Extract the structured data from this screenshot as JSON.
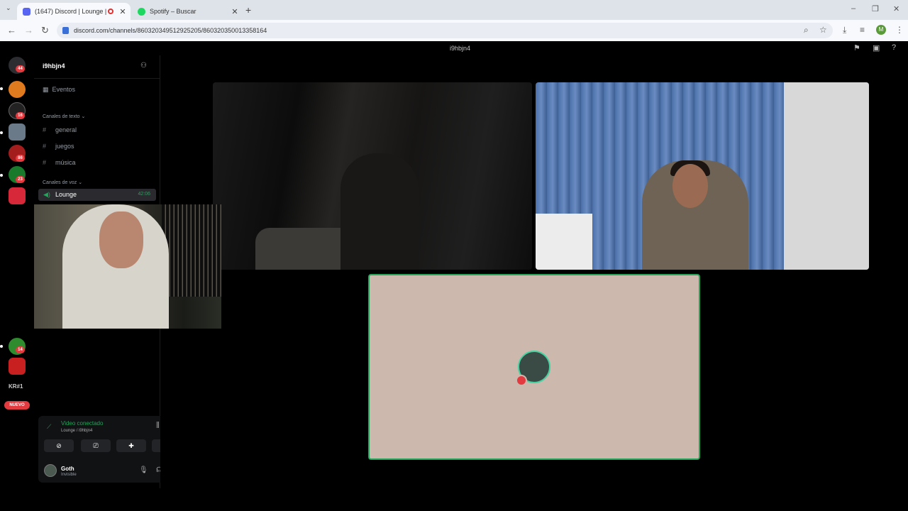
{
  "browser": {
    "tabs": [
      {
        "title": "(1647) Discord | Lounge | 9",
        "active": true,
        "favicon_color": "#5865f2"
      },
      {
        "title": "Spotify – Buscar",
        "active": false,
        "favicon_color": "#1ed760"
      }
    ],
    "url": "discord.com/channels/860320349512925205/860320350013358164"
  },
  "discord": {
    "top_channel": "i9hbjn4",
    "server_name": "i9hbjn4",
    "events_label": "Eventos",
    "text_category": "Canales de texto",
    "text_channels": [
      "general",
      "juegos",
      "música"
    ],
    "voice_category": "Canales de voz",
    "voice_channel": {
      "name": "Lounge",
      "time": "42:06"
    },
    "guilds": [
      {
        "badge": "44",
        "color": "#2b2d31"
      },
      {
        "badge": "",
        "color": "#e07a1f"
      },
      {
        "badge": "16",
        "color": "#222"
      },
      {
        "badge": "",
        "color": "#6b7a88"
      },
      {
        "badge": "86",
        "color": "#a31d1d"
      },
      {
        "badge": "23",
        "color": "#1a7a2c"
      },
      {
        "badge": "",
        "color": "#d62839"
      },
      {
        "badge": "14",
        "color": "#2e8b2e"
      },
      {
        "badge": "",
        "color": "#c82020"
      }
    ],
    "guild_text": "KR#1",
    "nuevo_label": "NUEVO",
    "voice_panel": {
      "status": "Video conectado",
      "subtitle": "Lounge / i9hbjn4"
    },
    "user": {
      "name": "Goth",
      "status": "Invisible"
    }
  },
  "icons": {
    "accent": "#23a55a",
    "danger": "#e23a3f"
  }
}
